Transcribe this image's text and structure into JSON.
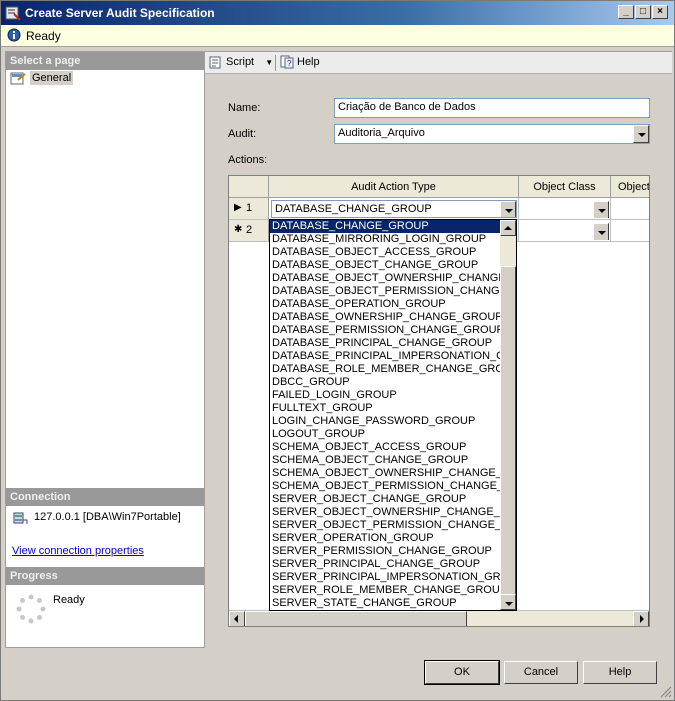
{
  "window": {
    "title": "Create Server Audit Specification"
  },
  "status": {
    "text": "Ready"
  },
  "left": {
    "select_page_header": "Select a page",
    "pages": [
      "General"
    ],
    "connection_header": "Connection",
    "connection_text": "127.0.0.1 [DBA\\Win7Portable]",
    "connection_link": "View connection properties",
    "progress_header": "Progress",
    "progress_text": "Ready"
  },
  "toolbar": {
    "script_label": "Script",
    "help_label": "Help"
  },
  "form": {
    "name_label": "Name:",
    "name_value": "Criação de Banco de Dados",
    "audit_label": "Audit:",
    "audit_value": "Auditoria_Arquivo",
    "actions_label": "Actions:"
  },
  "grid": {
    "columns": [
      "Audit Action Type",
      "Object Class",
      "Object"
    ],
    "rows": [
      {
        "marker": "▶",
        "num": "1",
        "action": "DATABASE_CHANGE_GROUP"
      },
      {
        "marker": "✱",
        "num": "2",
        "action": ""
      }
    ]
  },
  "dropdown": {
    "items": [
      "DATABASE_CHANGE_GROUP",
      "DATABASE_MIRRORING_LOGIN_GROUP",
      "DATABASE_OBJECT_ACCESS_GROUP",
      "DATABASE_OBJECT_CHANGE_GROUP",
      "DATABASE_OBJECT_OWNERSHIP_CHANGE_GROUP",
      "DATABASE_OBJECT_PERMISSION_CHANGE_GROUP",
      "DATABASE_OPERATION_GROUP",
      "DATABASE_OWNERSHIP_CHANGE_GROUP",
      "DATABASE_PERMISSION_CHANGE_GROUP",
      "DATABASE_PRINCIPAL_CHANGE_GROUP",
      "DATABASE_PRINCIPAL_IMPERSONATION_GROUP",
      "DATABASE_ROLE_MEMBER_CHANGE_GROUP",
      "DBCC_GROUP",
      "FAILED_LOGIN_GROUP",
      "FULLTEXT_GROUP",
      "LOGIN_CHANGE_PASSWORD_GROUP",
      "LOGOUT_GROUP",
      "SCHEMA_OBJECT_ACCESS_GROUP",
      "SCHEMA_OBJECT_CHANGE_GROUP",
      "SCHEMA_OBJECT_OWNERSHIP_CHANGE_GROUP",
      "SCHEMA_OBJECT_PERMISSION_CHANGE_GROUP",
      "SERVER_OBJECT_CHANGE_GROUP",
      "SERVER_OBJECT_OWNERSHIP_CHANGE_GROUP",
      "SERVER_OBJECT_PERMISSION_CHANGE_GROUP",
      "SERVER_OPERATION_GROUP",
      "SERVER_PERMISSION_CHANGE_GROUP",
      "SERVER_PRINCIPAL_CHANGE_GROUP",
      "SERVER_PRINCIPAL_IMPERSONATION_GROUP",
      "SERVER_ROLE_MEMBER_CHANGE_GROUP",
      "SERVER_STATE_CHANGE_GROUP"
    ],
    "selected_index": 0
  },
  "buttons": {
    "ok": "OK",
    "cancel": "Cancel",
    "help": "Help"
  },
  "colors": {
    "selection": "#0a246a",
    "link": "#0000cc",
    "status_bg": "#ffffe1"
  }
}
